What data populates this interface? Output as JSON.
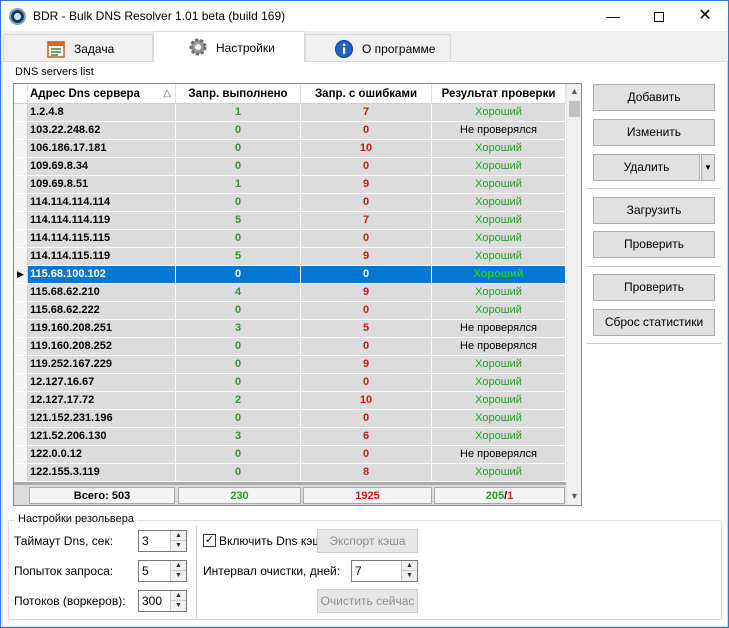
{
  "window": {
    "title": "BDR - Bulk DNS Resolver 1.01 beta (build 169)"
  },
  "tabs": [
    {
      "label": "Задача",
      "icon": "calendar-icon"
    },
    {
      "label": "Настройки",
      "icon": "gear-icon"
    },
    {
      "label": "О программе",
      "icon": "info-icon"
    }
  ],
  "dns_list": {
    "group_title": "DNS servers list",
    "columns": [
      "Адрес Dns сервера",
      "Запр. выполнено",
      "Запр. с ошибками",
      "Результат проверки"
    ],
    "rows": [
      {
        "addr": "1.2.4.8",
        "ok": "1",
        "err": "7",
        "result": "Хороший"
      },
      {
        "addr": "103.22.248.62",
        "ok": "0",
        "err": "0",
        "result": "Не проверялся"
      },
      {
        "addr": "106.186.17.181",
        "ok": "0",
        "err": "10",
        "result": "Хороший"
      },
      {
        "addr": "109.69.8.34",
        "ok": "0",
        "err": "0",
        "result": "Хороший"
      },
      {
        "addr": "109.69.8.51",
        "ok": "1",
        "err": "9",
        "result": "Хороший"
      },
      {
        "addr": "114.114.114.114",
        "ok": "0",
        "err": "0",
        "result": "Хороший"
      },
      {
        "addr": "114.114.114.119",
        "ok": "5",
        "err": "7",
        "result": "Хороший"
      },
      {
        "addr": "114.114.115.115",
        "ok": "0",
        "err": "0",
        "result": "Хороший"
      },
      {
        "addr": "114.114.115.119",
        "ok": "5",
        "err": "9",
        "result": "Хороший"
      },
      {
        "addr": "115.68.100.102",
        "ok": "0",
        "err": "0",
        "result": "Хороший"
      },
      {
        "addr": "115.68.62.210",
        "ok": "4",
        "err": "9",
        "result": "Хороший"
      },
      {
        "addr": "115.68.62.222",
        "ok": "0",
        "err": "0",
        "result": "Хороший"
      },
      {
        "addr": "119.160.208.251",
        "ok": "3",
        "err": "5",
        "result": "Не проверялся"
      },
      {
        "addr": "119.160.208.252",
        "ok": "0",
        "err": "0",
        "result": "Не проверялся"
      },
      {
        "addr": "119.252.167.229",
        "ok": "0",
        "err": "9",
        "result": "Хороший"
      },
      {
        "addr": "12.127.16.67",
        "ok": "0",
        "err": "0",
        "result": "Хороший"
      },
      {
        "addr": "12.127.17.72",
        "ok": "2",
        "err": "10",
        "result": "Хороший"
      },
      {
        "addr": "121.152.231.196",
        "ok": "0",
        "err": "0",
        "result": "Хороший"
      },
      {
        "addr": "121.52.206.130",
        "ok": "3",
        "err": "6",
        "result": "Хороший"
      },
      {
        "addr": "122.0.0.12",
        "ok": "0",
        "err": "0",
        "result": "Не проверялся"
      },
      {
        "addr": "122.155.3.119",
        "ok": "0",
        "err": "8",
        "result": "Хороший"
      }
    ],
    "selected_row": "115.68.100.102",
    "footer": {
      "total": "Всего: 503",
      "ok": "230",
      "err": "1925",
      "good": "205",
      "slash": "/",
      "bad": "1"
    }
  },
  "side_buttons": {
    "add": "Добавить",
    "edit": "Изменить",
    "delete": "Удалить",
    "load": "Загрузить",
    "check": "Проверить",
    "check2": "Проверить",
    "reset": "Сброс статистики"
  },
  "resolver": {
    "group_title": "Настройки резольвера",
    "timeout_label": "Таймаут Dns, сек:",
    "timeout_value": "3",
    "retries_label": "Попыток запроса:",
    "retries_value": "5",
    "threads_label": "Потоков (воркеров):",
    "threads_value": "300",
    "cache_checkbox_label": "Включить Dns кэш",
    "cache_checked": true,
    "export_cache": "Экспорт кэша",
    "interval_label": "Интервал очистки, дней:",
    "interval_value": "7",
    "clear_now": "Очистить сейчас"
  },
  "colors": {
    "good": "#22a022",
    "error": "#e01010",
    "selection": "#0078d7"
  }
}
